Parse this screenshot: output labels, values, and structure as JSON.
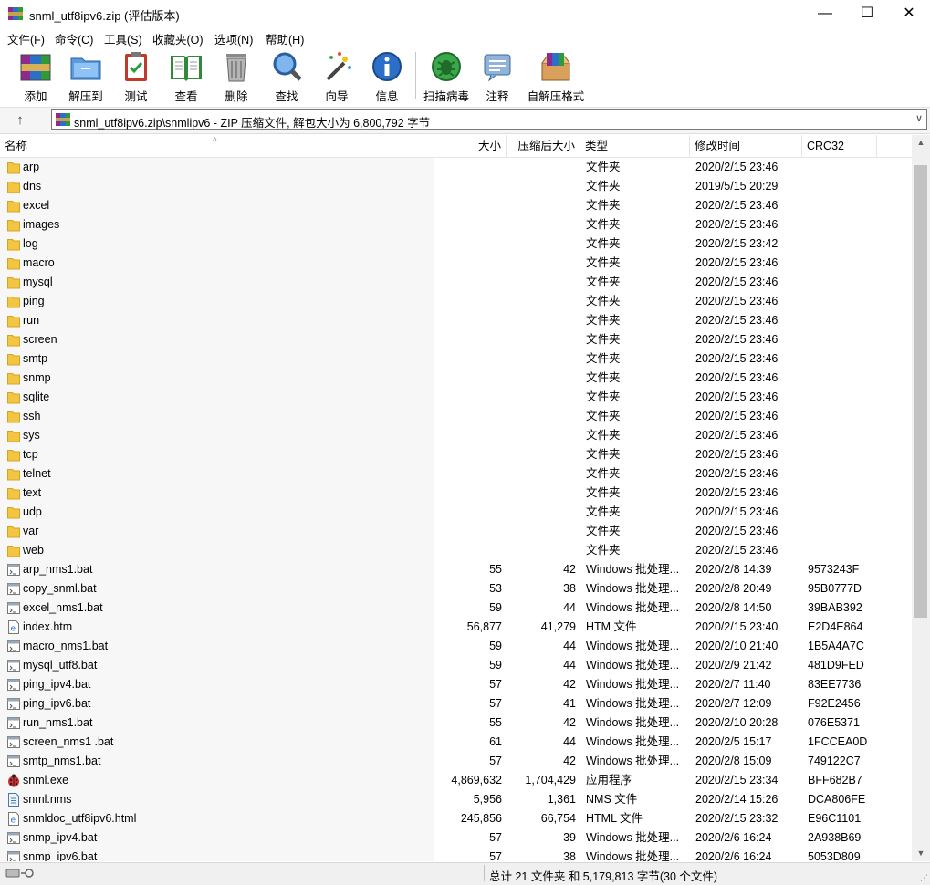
{
  "window": {
    "title": "snml_utf8ipv6.zip (评估版本)",
    "minimize": "—",
    "maximize": "☐",
    "close": "✕"
  },
  "menu": [
    "文件(F)",
    "命令(C)",
    "工具(S)",
    "收藏夹(O)",
    "选项(N)",
    "帮助(H)"
  ],
  "toolbar": [
    {
      "label": "添加",
      "icon": "add-archive-icon"
    },
    {
      "label": "解压到",
      "icon": "extract-folder-icon"
    },
    {
      "label": "测试",
      "icon": "test-clipboard-icon"
    },
    {
      "label": "查看",
      "icon": "view-book-icon"
    },
    {
      "label": "删除",
      "icon": "trash-icon"
    },
    {
      "label": "查找",
      "icon": "magnifier-icon"
    },
    {
      "label": "向导",
      "icon": "wizard-wand-icon"
    },
    {
      "label": "信息",
      "icon": "info-icon"
    },
    {
      "label": "扫描病毒",
      "icon": "virus-scan-icon"
    },
    {
      "label": "注释",
      "icon": "comment-icon"
    },
    {
      "label": "自解压格式",
      "icon": "sfx-box-icon"
    }
  ],
  "address": {
    "path": "snml_utf8ipv6.zip\\snmlipv6 - ZIP 压缩文件, 解包大小为 6,800,792 字节"
  },
  "columns": {
    "name": "名称",
    "size": "大小",
    "packed": "压缩后大小",
    "type": "类型",
    "modified": "修改时间",
    "crc": "CRC32"
  },
  "files": [
    {
      "name": "arp",
      "kind": "folder",
      "size": "",
      "packed": "",
      "type": "文件夹",
      "modified": "2020/2/15 23:46",
      "crc": ""
    },
    {
      "name": "dns",
      "kind": "folder",
      "size": "",
      "packed": "",
      "type": "文件夹",
      "modified": "2019/5/15 20:29",
      "crc": ""
    },
    {
      "name": "excel",
      "kind": "folder",
      "size": "",
      "packed": "",
      "type": "文件夹",
      "modified": "2020/2/15 23:46",
      "crc": ""
    },
    {
      "name": "images",
      "kind": "folder",
      "size": "",
      "packed": "",
      "type": "文件夹",
      "modified": "2020/2/15 23:46",
      "crc": ""
    },
    {
      "name": "log",
      "kind": "folder",
      "size": "",
      "packed": "",
      "type": "文件夹",
      "modified": "2020/2/15 23:42",
      "crc": ""
    },
    {
      "name": "macro",
      "kind": "folder",
      "size": "",
      "packed": "",
      "type": "文件夹",
      "modified": "2020/2/15 23:46",
      "crc": ""
    },
    {
      "name": "mysql",
      "kind": "folder",
      "size": "",
      "packed": "",
      "type": "文件夹",
      "modified": "2020/2/15 23:46",
      "crc": ""
    },
    {
      "name": "ping",
      "kind": "folder",
      "size": "",
      "packed": "",
      "type": "文件夹",
      "modified": "2020/2/15 23:46",
      "crc": ""
    },
    {
      "name": "run",
      "kind": "folder",
      "size": "",
      "packed": "",
      "type": "文件夹",
      "modified": "2020/2/15 23:46",
      "crc": ""
    },
    {
      "name": "screen",
      "kind": "folder",
      "size": "",
      "packed": "",
      "type": "文件夹",
      "modified": "2020/2/15 23:46",
      "crc": ""
    },
    {
      "name": "smtp",
      "kind": "folder",
      "size": "",
      "packed": "",
      "type": "文件夹",
      "modified": "2020/2/15 23:46",
      "crc": ""
    },
    {
      "name": "snmp",
      "kind": "folder",
      "size": "",
      "packed": "",
      "type": "文件夹",
      "modified": "2020/2/15 23:46",
      "crc": ""
    },
    {
      "name": "sqlite",
      "kind": "folder",
      "size": "",
      "packed": "",
      "type": "文件夹",
      "modified": "2020/2/15 23:46",
      "crc": ""
    },
    {
      "name": "ssh",
      "kind": "folder",
      "size": "",
      "packed": "",
      "type": "文件夹",
      "modified": "2020/2/15 23:46",
      "crc": ""
    },
    {
      "name": "sys",
      "kind": "folder",
      "size": "",
      "packed": "",
      "type": "文件夹",
      "modified": "2020/2/15 23:46",
      "crc": ""
    },
    {
      "name": "tcp",
      "kind": "folder",
      "size": "",
      "packed": "",
      "type": "文件夹",
      "modified": "2020/2/15 23:46",
      "crc": ""
    },
    {
      "name": "telnet",
      "kind": "folder",
      "size": "",
      "packed": "",
      "type": "文件夹",
      "modified": "2020/2/15 23:46",
      "crc": ""
    },
    {
      "name": "text",
      "kind": "folder",
      "size": "",
      "packed": "",
      "type": "文件夹",
      "modified": "2020/2/15 23:46",
      "crc": ""
    },
    {
      "name": "udp",
      "kind": "folder",
      "size": "",
      "packed": "",
      "type": "文件夹",
      "modified": "2020/2/15 23:46",
      "crc": ""
    },
    {
      "name": "var",
      "kind": "folder",
      "size": "",
      "packed": "",
      "type": "文件夹",
      "modified": "2020/2/15 23:46",
      "crc": ""
    },
    {
      "name": "web",
      "kind": "folder",
      "size": "",
      "packed": "",
      "type": "文件夹",
      "modified": "2020/2/15 23:46",
      "crc": ""
    },
    {
      "name": "arp_nms1.bat",
      "kind": "bat",
      "size": "55",
      "packed": "42",
      "type": "Windows 批处理...",
      "modified": "2020/2/8 14:39",
      "crc": "9573243F"
    },
    {
      "name": "copy_snml.bat",
      "kind": "bat",
      "size": "53",
      "packed": "38",
      "type": "Windows 批处理...",
      "modified": "2020/2/8 20:49",
      "crc": "95B0777D"
    },
    {
      "name": "excel_nms1.bat",
      "kind": "bat",
      "size": "59",
      "packed": "44",
      "type": "Windows 批处理...",
      "modified": "2020/2/8 14:50",
      "crc": "39BAB392"
    },
    {
      "name": "index.htm",
      "kind": "htm",
      "size": "56,877",
      "packed": "41,279",
      "type": "HTM 文件",
      "modified": "2020/2/15 23:40",
      "crc": "E2D4E864"
    },
    {
      "name": "macro_nms1.bat",
      "kind": "bat",
      "size": "59",
      "packed": "44",
      "type": "Windows 批处理...",
      "modified": "2020/2/10 21:40",
      "crc": "1B5A4A7C"
    },
    {
      "name": "mysql_utf8.bat",
      "kind": "bat",
      "size": "59",
      "packed": "44",
      "type": "Windows 批处理...",
      "modified": "2020/2/9 21:42",
      "crc": "481D9FED"
    },
    {
      "name": "ping_ipv4.bat",
      "kind": "bat",
      "size": "57",
      "packed": "42",
      "type": "Windows 批处理...",
      "modified": "2020/2/7 11:40",
      "crc": "83EE7736"
    },
    {
      "name": "ping_ipv6.bat",
      "kind": "bat",
      "size": "57",
      "packed": "41",
      "type": "Windows 批处理...",
      "modified": "2020/2/7 12:09",
      "crc": "F92E2456"
    },
    {
      "name": "run_nms1.bat",
      "kind": "bat",
      "size": "55",
      "packed": "42",
      "type": "Windows 批处理...",
      "modified": "2020/2/10 20:28",
      "crc": "076E5371"
    },
    {
      "name": "screen_nms1 .bat",
      "kind": "bat",
      "size": "61",
      "packed": "44",
      "type": "Windows 批处理...",
      "modified": "2020/2/5 15:17",
      "crc": "1FCCEA0D"
    },
    {
      "name": "smtp_nms1.bat",
      "kind": "bat",
      "size": "57",
      "packed": "42",
      "type": "Windows 批处理...",
      "modified": "2020/2/8 15:09",
      "crc": "749122C7"
    },
    {
      "name": "snml.exe",
      "kind": "exe",
      "size": "4,869,632",
      "packed": "1,704,429",
      "type": "应用程序",
      "modified": "2020/2/15 23:34",
      "crc": "BFF682B7"
    },
    {
      "name": "snml.nms",
      "kind": "nms",
      "size": "5,956",
      "packed": "1,361",
      "type": "NMS 文件",
      "modified": "2020/2/14 15:26",
      "crc": "DCA806FE"
    },
    {
      "name": "snmldoc_utf8ipv6.html",
      "kind": "htm",
      "size": "245,856",
      "packed": "66,754",
      "type": "HTML 文件",
      "modified": "2020/2/15 23:32",
      "crc": "E96C1101"
    },
    {
      "name": "snmp_ipv4.bat",
      "kind": "bat",
      "size": "57",
      "packed": "39",
      "type": "Windows 批处理...",
      "modified": "2020/2/6 16:24",
      "crc": "2A938B69"
    },
    {
      "name": "snmp_ipv6.bat",
      "kind": "bat",
      "size": "57",
      "packed": "38",
      "type": "Windows 批处理...",
      "modified": "2020/2/6 16:24",
      "crc": "5053D809"
    }
  ],
  "status": {
    "summary": "总计 21 文件夹 和 5,179,813 字节(30 个文件)"
  },
  "colors": {
    "folder": "#f4c542",
    "name_column_bg": "#f7f7f7",
    "scrollbar_thumb": "#c2c2c2"
  }
}
